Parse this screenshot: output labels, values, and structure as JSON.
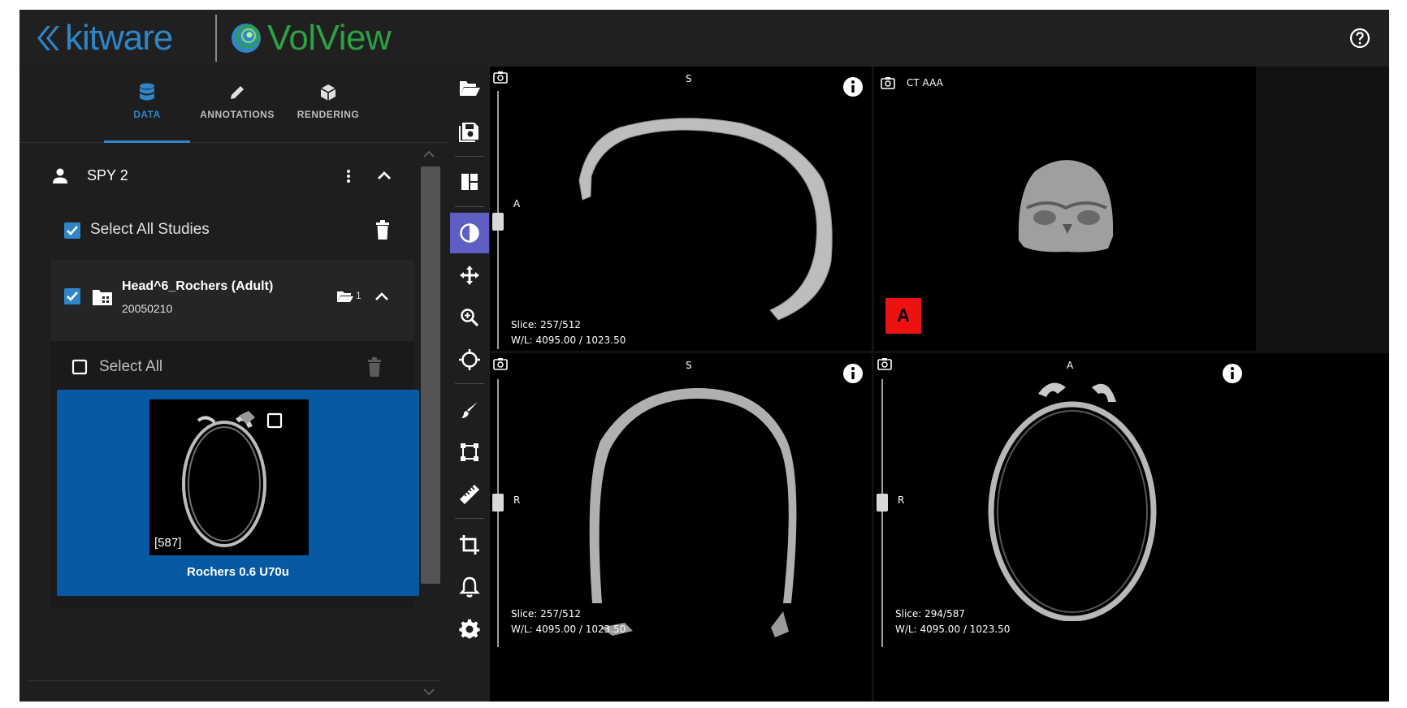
{
  "header": {
    "brand_left": "kitware",
    "brand_right": "VolView",
    "help_icon": "help-circle-icon"
  },
  "tabs": [
    {
      "label": "DATA",
      "icon": "database-icon",
      "active": true
    },
    {
      "label": "ANNOTATIONS",
      "icon": "pencil-icon",
      "active": false
    },
    {
      "label": "RENDERING",
      "icon": "cube-icon",
      "active": false
    }
  ],
  "patient": {
    "name": "SPY 2"
  },
  "studies": {
    "select_all_label": "Select All Studies",
    "select_all_checked": true,
    "items": [
      {
        "name": "Head^6_Rochers (Adult)",
        "date": "20050210",
        "series_count": "1",
        "checked": true,
        "select_all_label": "Select All",
        "series": [
          {
            "name": "Rochers 0.6 U70u",
            "count_label": "[587]"
          }
        ]
      }
    ]
  },
  "toolbar": {
    "tools": [
      {
        "name": "open-files",
        "icon": "folder-open-icon"
      },
      {
        "name": "save",
        "icon": "save-icon"
      },
      {
        "name": "layout",
        "icon": "layout-icon"
      },
      {
        "name": "window-level",
        "icon": "contrast-icon",
        "active": true
      },
      {
        "name": "pan",
        "icon": "move-icon"
      },
      {
        "name": "zoom",
        "icon": "zoom-icon"
      },
      {
        "name": "crosshairs",
        "icon": "crosshair-icon"
      },
      {
        "name": "paint",
        "icon": "brush-icon"
      },
      {
        "name": "rectangle",
        "icon": "rectangle-icon"
      },
      {
        "name": "ruler",
        "icon": "ruler-icon"
      },
      {
        "name": "crop",
        "icon": "crop-icon"
      },
      {
        "name": "notifications",
        "icon": "bell-icon"
      },
      {
        "name": "settings",
        "icon": "gear-icon"
      }
    ]
  },
  "views": {
    "top_left": {
      "top_label": "S",
      "side_label": "A",
      "slice": "Slice: 257/512",
      "wl": "W/L: 4095.00 / 1023.50"
    },
    "top_right": {
      "title": "CT AAA",
      "orient_badge": "A"
    },
    "bottom_left": {
      "top_label": "S",
      "side_label": "R",
      "slice": "Slice: 257/512",
      "wl": "W/L: 4095.00 / 1023.50"
    },
    "bottom_right": {
      "top_label": "A",
      "side_label": "R",
      "slice": "Slice: 294/587",
      "wl": "W/L: 4095.00 / 1023.50"
    }
  },
  "colors": {
    "accent_blue": "#2e86c8",
    "brand_green": "#2ea043",
    "series_selected": "#0759a3",
    "tool_active": "#5f5ec2",
    "badge_red": "#ee1111"
  }
}
